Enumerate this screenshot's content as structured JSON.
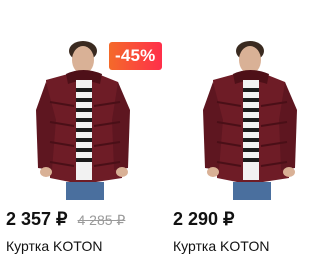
{
  "products": [
    {
      "discount_badge": "-45%",
      "price": "2 357 ₽",
      "old_price": "4 285 ₽",
      "title": "Куртка KOTON",
      "image": "man-in-burgundy-puffer-jacket"
    },
    {
      "price": "2 290 ₽",
      "title": "Куртка KOTON",
      "image": "man-in-burgundy-puffer-jacket"
    }
  ],
  "colors": {
    "badge_gradient_start": "#f46a2a",
    "badge_gradient_end": "#ff2f4a",
    "jacket": "#6e1c26",
    "price_text": "#111111",
    "old_price_text": "#9a9a9a"
  }
}
